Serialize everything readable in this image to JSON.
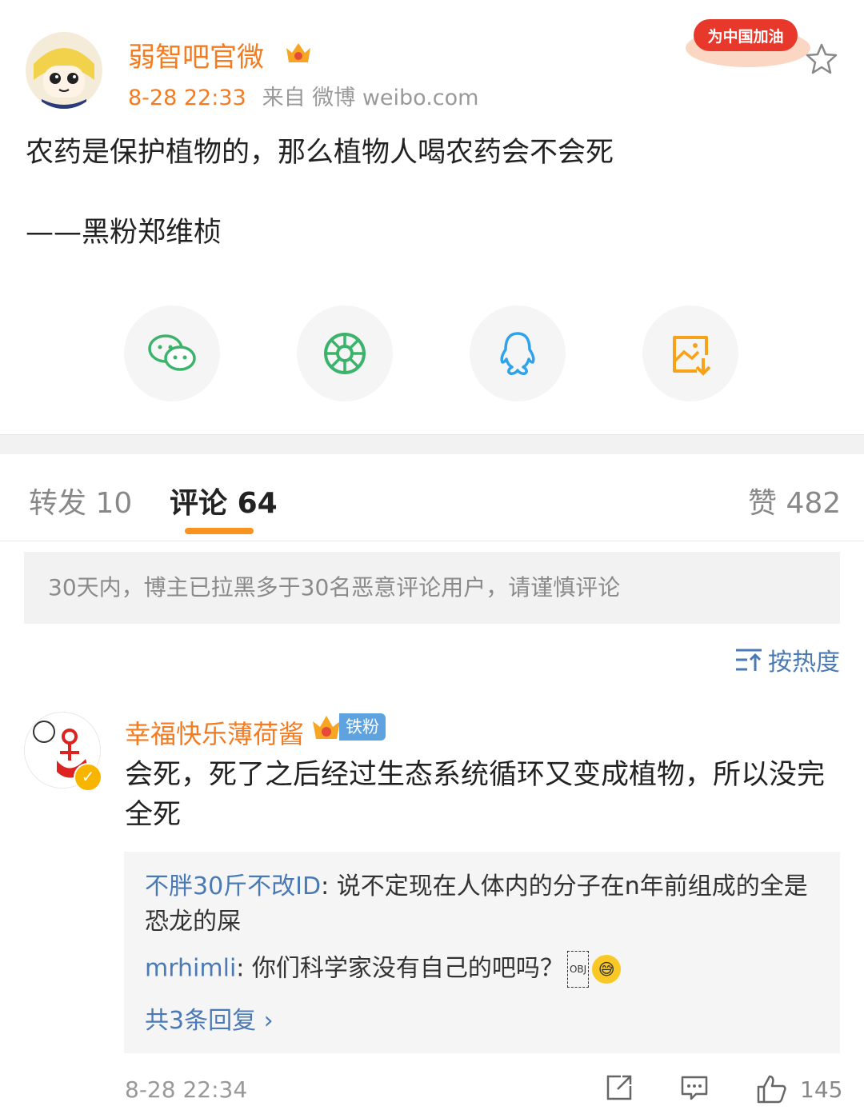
{
  "post": {
    "author": "弱智吧官微",
    "time": "8-28 22:33",
    "source": "来自 微博 weibo.com",
    "badge_text": "为中国加油",
    "content": "农药是保护植物的，那么植物人喝农药会不会死\n\n——黑粉郑维桢"
  },
  "share_icons": [
    "wechat-icon",
    "moments-icon",
    "qq-icon",
    "save-image-icon"
  ],
  "tabs": {
    "repost_label": "转发",
    "repost_count": "10",
    "comment_label": "评论",
    "comment_count": "64",
    "like_label": "赞",
    "like_count": "482"
  },
  "notice": "30天内，博主已拉黑多于30名恶意评论用户，请谨慎评论",
  "sort_label": "按热度",
  "comment": {
    "author": "幸福快乐薄荷酱",
    "fan_badge": "铁粉",
    "text": "会死，死了之后经过生态系统循环又变成植物，所以没完全死",
    "replies": [
      {
        "user": "不胖30斤不改ID",
        "text": ": 说不定现在人体内的分子在n年前组成的全是恐龙的屎"
      },
      {
        "user": "mrhimli",
        "text": ": 你们科学家没有自己的吧吗？"
      }
    ],
    "obj_text": "OBJ",
    "more_replies": "共3条回复 ›",
    "time": "8-28 22:34",
    "likes": "145"
  },
  "colors": {
    "accent": "#f47b20",
    "link": "#4a7ab5",
    "tab_underline": "#f7931e"
  }
}
